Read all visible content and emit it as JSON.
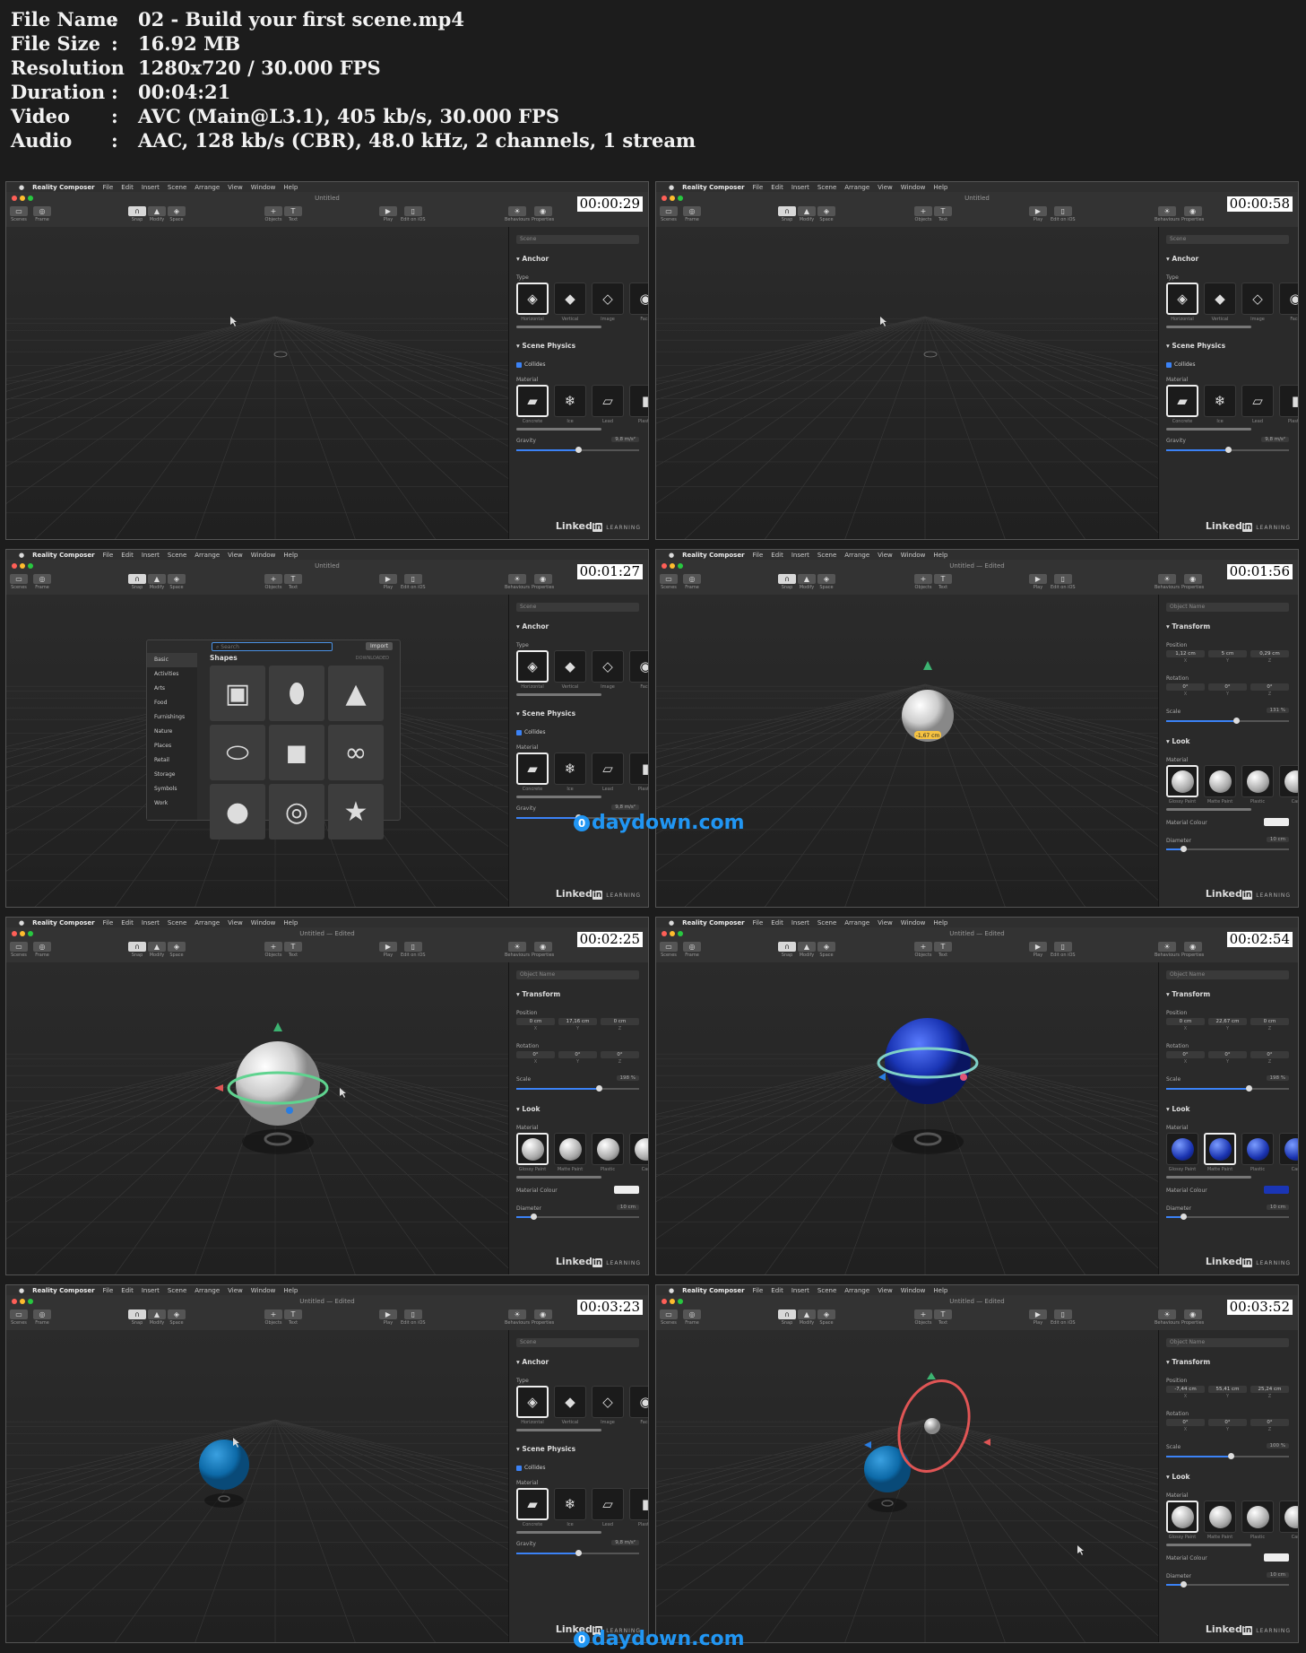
{
  "info": [
    {
      "key": "File Name",
      "value": "02 - Build your first scene.mp4"
    },
    {
      "key": "File Size",
      "value": "16.92 MB"
    },
    {
      "key": "Resolution",
      "value": "1280x720 / 30.000 FPS"
    },
    {
      "key": "Duration",
      "value": "00:04:21"
    },
    {
      "key": "Video",
      "value": "AVC (Main@L3.1), 405 kb/s, 30.000 FPS"
    },
    {
      "key": "Audio",
      "value": "AAC, 128 kb/s (CBR), 48.0 kHz, 2 channels, 1 stream"
    }
  ],
  "info_separator": ":",
  "app": {
    "apple": "",
    "menu": [
      "Reality Composer",
      "File",
      "Edit",
      "Insert",
      "Scene",
      "Arrange",
      "View",
      "Window",
      "Help"
    ],
    "toolbar": {
      "scenes": "Scenes",
      "frame": "Frame",
      "snap": "Snap",
      "modify": "Modify",
      "space": "Space",
      "objects": "Objects",
      "text": "Text",
      "play": "Play",
      "edit_ios": "Edit on iOS",
      "behaviours": "Behaviours",
      "properties": "Properties"
    },
    "colors": {
      "close": "#ff5f57",
      "minimize": "#febc2e",
      "zoom": "#28c840",
      "accent": "#3b82f6"
    }
  },
  "scene_panel": {
    "field": "Scene",
    "anchor": "Anchor",
    "type_label": "Type",
    "types": [
      "Horizontal",
      "Vertical",
      "Image",
      "Face"
    ],
    "physics": "Scene Physics",
    "collides": "Collides",
    "material_label": "Material",
    "materials": [
      "Concrete",
      "Ice",
      "Lead",
      "Plastic"
    ],
    "gravity_label": "Gravity",
    "gravity_value": "9,8 m/s²"
  },
  "object_panel": {
    "field": "Object Name",
    "transform": "Transform",
    "position": "Position",
    "rotation": "Rotation",
    "scale": "Scale",
    "axes": [
      "X",
      "Y",
      "Z"
    ],
    "look": "Look",
    "material_label": "Material",
    "materials": [
      "Glossy Paint",
      "Matte Paint",
      "Plastic",
      "Car"
    ],
    "colour_label": "Material Colour",
    "diameter_label": "Diameter",
    "diameter_value": "10 cm"
  },
  "library": {
    "search": "Search",
    "import": "Import",
    "categories": [
      "Basic",
      "Activities",
      "Arts",
      "Food",
      "Furnishings",
      "Nature",
      "Places",
      "Retail",
      "Storage",
      "Symbols",
      "Work"
    ],
    "heading": "Shapes",
    "downloaded": "DOWNLOADED",
    "shapes": [
      "cube",
      "capsule",
      "cone",
      "cylinder",
      "box",
      "torus-knot",
      "sphere",
      "spiral",
      "star"
    ]
  },
  "brand": {
    "linkedin": "Linked",
    "in": "in",
    "learning": "LEARNING"
  },
  "watermark": "daydown.com",
  "frames": [
    {
      "time": "00:00:29",
      "title": "Untitled",
      "mode": "scene",
      "scene": "empty"
    },
    {
      "time": "00:00:58",
      "title": "Untitled",
      "mode": "scene",
      "scene": "empty"
    },
    {
      "time": "00:01:27",
      "title": "Untitled",
      "mode": "scene",
      "scene": "library"
    },
    {
      "time": "00:01:56",
      "title": "Untitled — Edited",
      "mode": "object",
      "scene": "sphere-small",
      "pos": [
        "1,12 cm",
        "5 cm",
        "0,29 cm"
      ],
      "rot": [
        "0°",
        "0°",
        "0°"
      ],
      "scale": "131 %",
      "scale_level": 0.55,
      "badge": "-1,67 cm",
      "sphere_color": "white"
    },
    {
      "time": "00:02:25",
      "title": "Untitled — Edited",
      "mode": "object",
      "scene": "sphere-ring",
      "pos": [
        "0 cm",
        "17,16 cm",
        "0 cm"
      ],
      "rot": [
        "0°",
        "0°",
        "0°"
      ],
      "scale": "198 %",
      "scale_level": 0.65,
      "sphere_color": "white"
    },
    {
      "time": "00:02:54",
      "title": "Untitled — Edited",
      "mode": "object",
      "scene": "sphere-blue",
      "pos": [
        "0 cm",
        "22,67 cm",
        "0 cm"
      ],
      "rot": [
        "0°",
        "0°",
        "0°"
      ],
      "scale": "198 %",
      "scale_level": 0.65,
      "sphere_color": "blue"
    },
    {
      "time": "00:03:23",
      "title": "Untitled — Edited",
      "mode": "scene",
      "scene": "ball-teal"
    },
    {
      "time": "00:03:52",
      "title": "Untitled — Edited",
      "mode": "object",
      "scene": "red-ring",
      "pos": [
        "-7,44 cm",
        "55,41 cm",
        "25,24 cm"
      ],
      "rot": [
        "0°",
        "0°",
        "0°"
      ],
      "scale": "100 %",
      "scale_level": 0.5,
      "sphere_color": "white"
    }
  ]
}
